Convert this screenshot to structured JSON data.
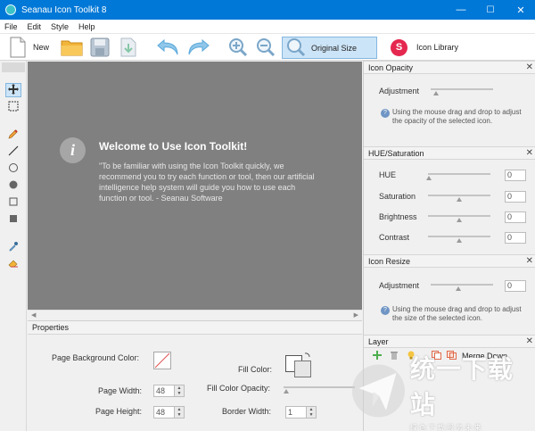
{
  "window": {
    "title": "Seanau Icon Toolkit 8",
    "controls": [
      "—",
      "☐",
      "✕"
    ]
  },
  "menu": [
    "File",
    "Edit",
    "Style",
    "Help"
  ],
  "toolbar": {
    "new_label": "New",
    "original_size_label": "Original Size",
    "library_label": "Icon Library",
    "library_badge": "S"
  },
  "canvas": {
    "welcome_icon": "i",
    "welcome_title": "Welcome to Use Icon Toolkit!",
    "welcome_body": "\"To be familiar with using the Icon Toolkit quickly, we recommend you to try each function or tool, then our artificial intelligence help system will guide you how to use each function or tool. - Seanau Software"
  },
  "properties": {
    "title": "Properties",
    "page_bg_label": "Page Background Color:",
    "fill_color_label": "Fill Color:",
    "page_width_label": "Page Width:",
    "page_width_value": "48",
    "fill_opacity_label": "Fill Color Opacity:",
    "page_height_label": "Page Height:",
    "page_height_value": "48",
    "border_width_label": "Border Width:",
    "border_width_value": "1"
  },
  "right": {
    "icon_opacity": {
      "title": "Icon Opacity",
      "adjustment_label": "Adjustment",
      "hint": "Using the mouse drag and drop to adjust the opacity of the selected icon."
    },
    "hue": {
      "title": "HUE/Saturation",
      "rows": [
        {
          "label": "HUE",
          "value": "0"
        },
        {
          "label": "Saturation",
          "value": "0"
        },
        {
          "label": "Brightness",
          "value": "0"
        },
        {
          "label": "Contrast",
          "value": "0"
        }
      ]
    },
    "resize": {
      "title": "Icon Resize",
      "adjustment_label": "Adjustment",
      "adjustment_value": "0",
      "hint": "Using the mouse drag and drop to adjust the size of the selected icon."
    },
    "layer": {
      "title": "Layer",
      "merge_down_label": "Merge Down"
    }
  },
  "watermark": {
    "main": "统一下载站",
    "sub": "绿 色 下 载   服 务 未 来"
  },
  "colors": {
    "titlebar": "#0078d7",
    "canvas": "#808080",
    "accent_badge": "#e5284f",
    "selected": "#cce4f7"
  }
}
